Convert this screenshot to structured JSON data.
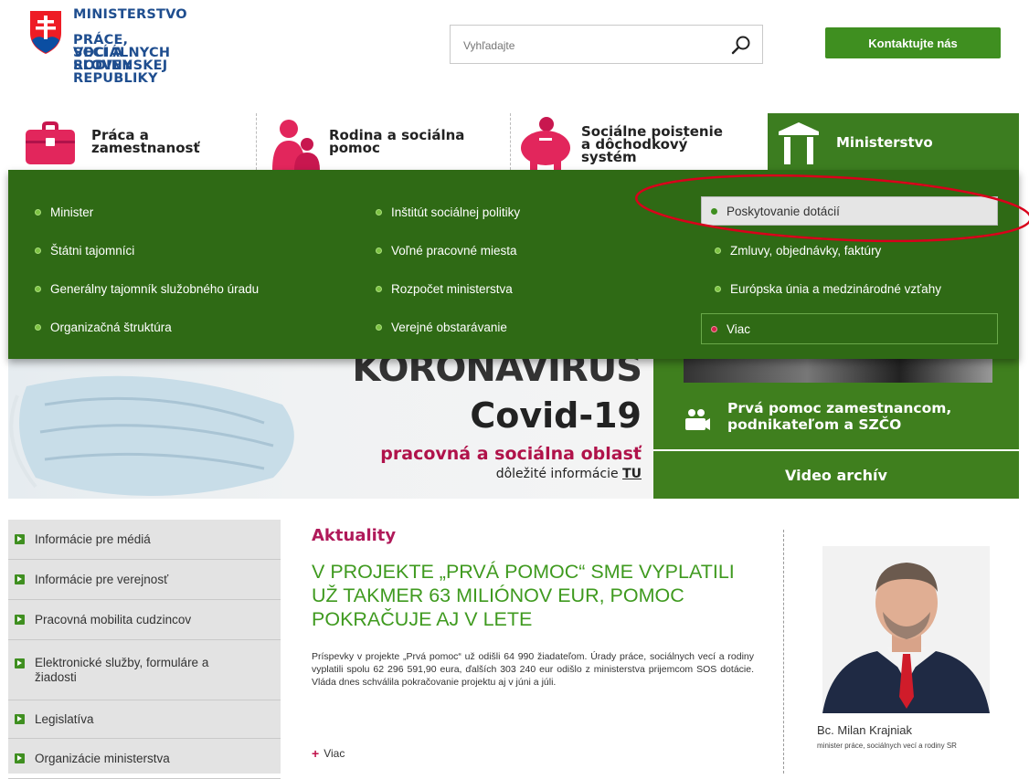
{
  "header": {
    "logo_lines": [
      "MINISTERSTVO",
      "PRÁCE, SOCIÁLNYCH",
      "VECÍ A RODINY",
      "SLOVENSKEJ REPUBLIKY"
    ],
    "search_placeholder": "Vyhľadajte",
    "contact_label": "Kontaktujte nás"
  },
  "nav": {
    "tabs": [
      {
        "label": "Práca a\nzamestnanosť",
        "icon": "briefcase-icon"
      },
      {
        "label": "Rodina a sociálna\npomoc",
        "icon": "people-icon"
      },
      {
        "label": "Sociálne poistenie\na dôchodkový\nsystém",
        "icon": "piggy-bank-icon"
      },
      {
        "label": "Ministerstvo",
        "icon": "building-icon"
      }
    ]
  },
  "menu": {
    "col1": [
      "Minister",
      "Štátni tajomníci",
      "Generálny tajomník služobného úradu",
      "Organizačná štruktúra"
    ],
    "col2": [
      "Inštitút sociálnej politiky",
      "Voľné pracovné miesta",
      "Rozpočet ministerstva",
      "Verejné obstarávanie"
    ],
    "col3": [
      "Poskytovanie dotácií",
      "Zmluvy, objednávky, faktúry",
      "Európska únia a medzinárodné vzťahy",
      "Viac"
    ]
  },
  "hero": {
    "title1": "KORONAVÍRUS",
    "title2": "Covid-19",
    "subtitle": "pracovná a sociálna oblasť",
    "info_text": "dôležité informácie ",
    "info_link": "TU"
  },
  "video": {
    "text": "Prvá pomoc zamestnancom,\npodnikateľom a SZČO",
    "archive_label": "Video archív"
  },
  "sidebar": {
    "items": [
      "Informácie pre médiá",
      "Informácie pre verejnosť",
      "Pracovná mobilita cudzincov",
      "Elektronické služby, formuláre a žiadosti",
      "Legislatíva",
      "Organizácie ministerstva"
    ]
  },
  "news": {
    "heading": "Aktuality",
    "title": "V PROJEKTE „PRVÁ POMOC“ SME VYPLATILI UŽ TAKMER 63 MILIÓNOV EUR, POMOC POKRAČUJE AJ V LETE",
    "body": "Príspevky v projekte „Prvá pomoc“ už odišli 64 990 žiadateľom. Úrady práce, sociálnych vecí a rodiny vyplatili spolu 62 296 591,90 eura, ďalších 303 240 eur odišlo z ministerstva prijemcom SOS dotácie. Vláda dnes schválila pokračovanie projektu aj v júni a júli.",
    "more_label": "Viac"
  },
  "minister": {
    "name": "Bc. Milan Krajniak",
    "role": "minister práce, sociálnych vecí a rodiny SR"
  },
  "colors": {
    "brand_green": "#3f8f20",
    "menu_green": "#2f6a15",
    "accent_magenta": "#b01a5a",
    "annotation_red": "#d9001b"
  }
}
